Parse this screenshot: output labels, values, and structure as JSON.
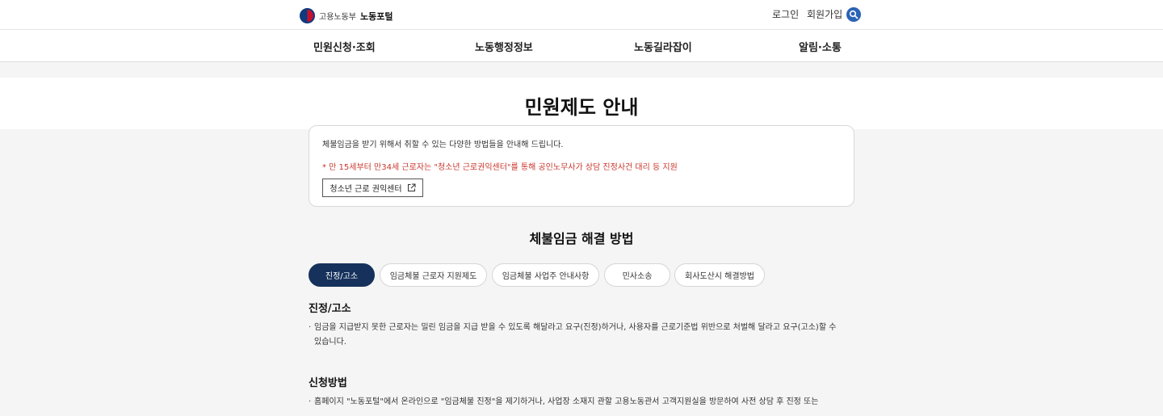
{
  "header": {
    "ministry": "고용노동부",
    "portal": "노동포털",
    "login": "로그인",
    "signup": "회원가입",
    "search_icon": "search-icon"
  },
  "gnb": [
    {
      "label": "민원신청·조회"
    },
    {
      "label": "노동행정정보"
    },
    {
      "label": "노동길라잡이"
    },
    {
      "label": "알림·소통"
    }
  ],
  "page": {
    "title": "민원제도 안내"
  },
  "info": {
    "text": "체불임금을 받기 위해서 취할 수 있는 다양한 방법들을 안내해 드립니다.",
    "notice": "* 만 15세부터 만34세 근로자는 \"청소년 근로권익센터\"를 통해 공인노무사가 상담 진정사건 대리 등 지원",
    "button": "청소년 근로 권익센터",
    "button_icon": "external-link-icon"
  },
  "section": {
    "title": "체불임금 해결 방법",
    "tabs": [
      {
        "label": "진정/고소",
        "active": true
      },
      {
        "label": "임금체불 근로자 지원제도"
      },
      {
        "label": "임금체불 사업주 안내사항"
      },
      {
        "label": "민사소송"
      },
      {
        "label": "회사도산시 해결방법"
      }
    ]
  },
  "content": {
    "heading1": "진정/고소",
    "para1_line1": "임금을 지급받지 못한 근로자는 밀린 임금을 지급 받을 수 있도록 해달라고 요구(진정)하거나, 사용자를 근로기준법 위반으로 처벌해 달라고 요구(고소)할 수",
    "para1_line2": "있습니다.",
    "heading2": "신청방법",
    "para2_line1": "홈페이지 \"노동포털\"에서 온라인으로 \"임금체불 진정\"을 제기하거나, 사업장 소재지 관할 고용노동관서 고객지원실을 방문하여 사전 상담 후 진정 또는",
    "bullet": "·"
  }
}
